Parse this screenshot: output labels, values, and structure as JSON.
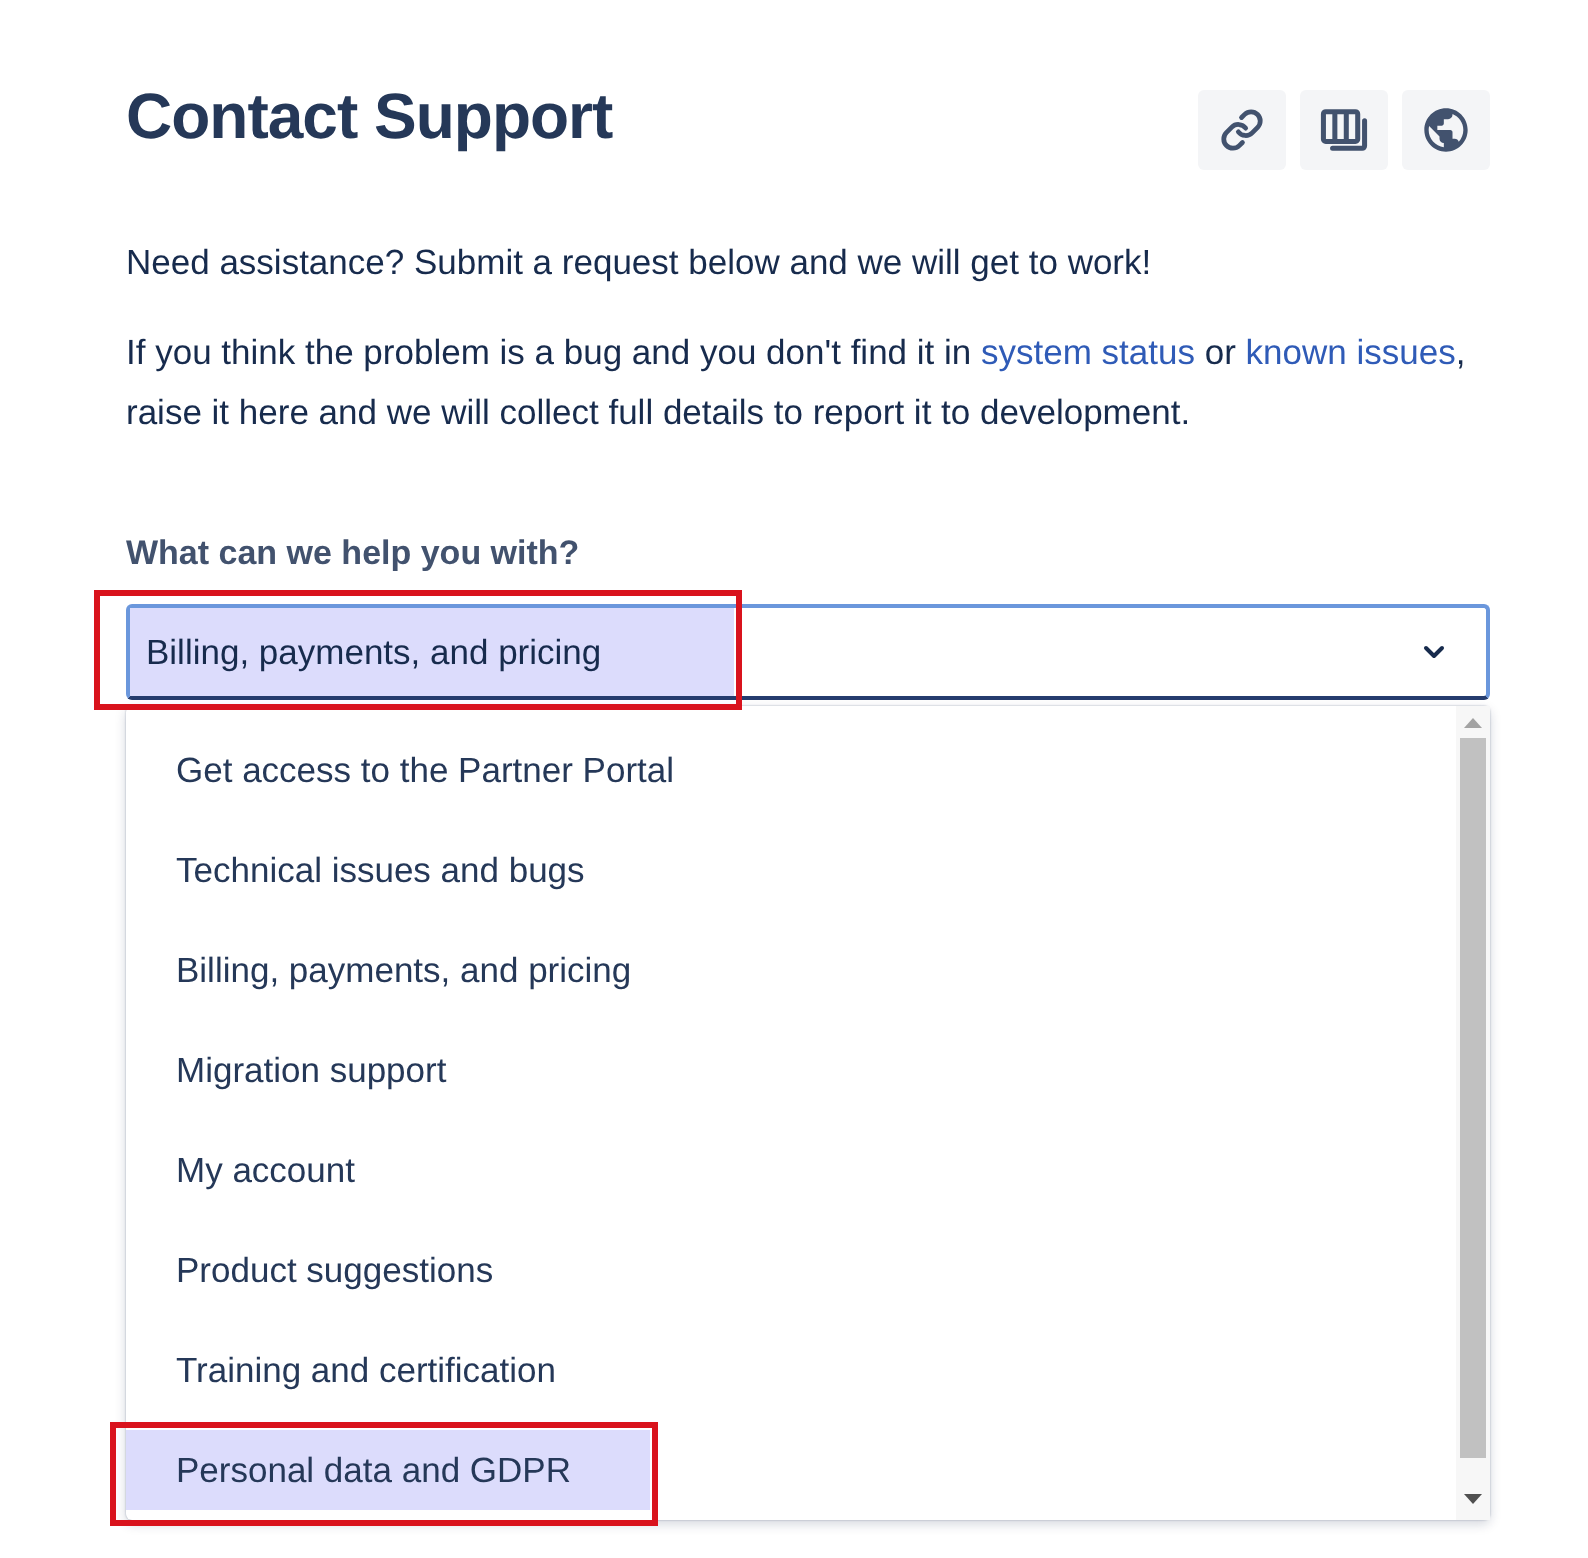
{
  "header": {
    "title": "Contact Support",
    "actions": [
      {
        "kind": "link"
      },
      {
        "kind": "columns"
      },
      {
        "kind": "globe"
      }
    ]
  },
  "intro": [
    {
      "segments": [
        {
          "kind": "text",
          "text": "Need assistance? Submit a request below and we will get to work!"
        }
      ]
    },
    {
      "segments": [
        {
          "kind": "text",
          "text": "If you think the problem is a bug and you don't find it in "
        },
        {
          "kind": "link",
          "text": "system status"
        },
        {
          "kind": "text",
          "text": " or "
        },
        {
          "kind": "link",
          "text": "known issues"
        },
        {
          "kind": "text",
          "text": ", raise it here and we will collect full details to report it to development."
        }
      ]
    }
  ],
  "form": {
    "label": "What can we help you with?",
    "select": {
      "value": "Billing, payments, and pricing",
      "highlighted": true,
      "expanded": true
    },
    "options": [
      {
        "label": "Get access to the Partner Portal",
        "highlighted": false
      },
      {
        "label": "Technical issues and bugs",
        "highlighted": false
      },
      {
        "label": "Billing, payments, and pricing",
        "highlighted": false
      },
      {
        "label": "Migration support",
        "highlighted": false
      },
      {
        "label": "My account",
        "highlighted": false
      },
      {
        "label": "Product suggestions",
        "highlighted": false
      },
      {
        "label": "Training and certification",
        "highlighted": false
      },
      {
        "label": "Personal data and GDPR",
        "highlighted": true
      }
    ]
  }
}
